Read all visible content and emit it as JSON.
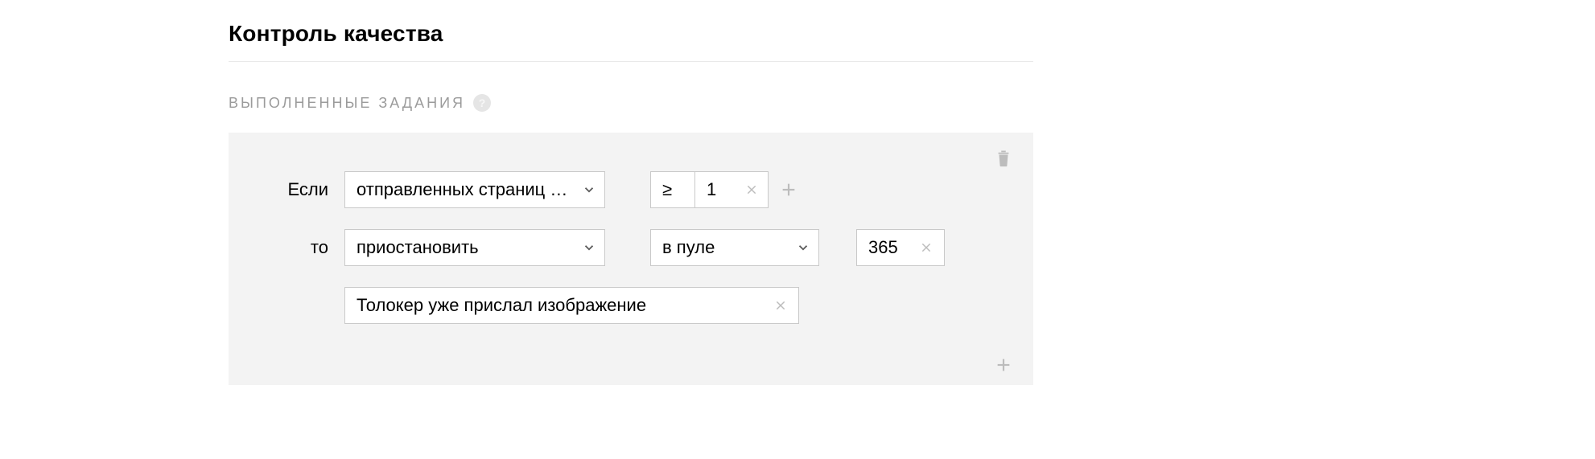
{
  "header": {
    "title": "Контроль качества"
  },
  "section": {
    "label": "ВЫПОЛНЕННЫЕ ЗАДАНИЯ",
    "help_glyph": "?"
  },
  "rule": {
    "if_label": "Если",
    "then_label": "то",
    "condition": {
      "field_selected": "отправленных страниц з…",
      "operator": "≥",
      "value": "1"
    },
    "action": {
      "type_selected": "приостановить",
      "scope_selected": "в пуле",
      "duration": "365",
      "reason": "Толокер уже прислал изображение"
    }
  }
}
